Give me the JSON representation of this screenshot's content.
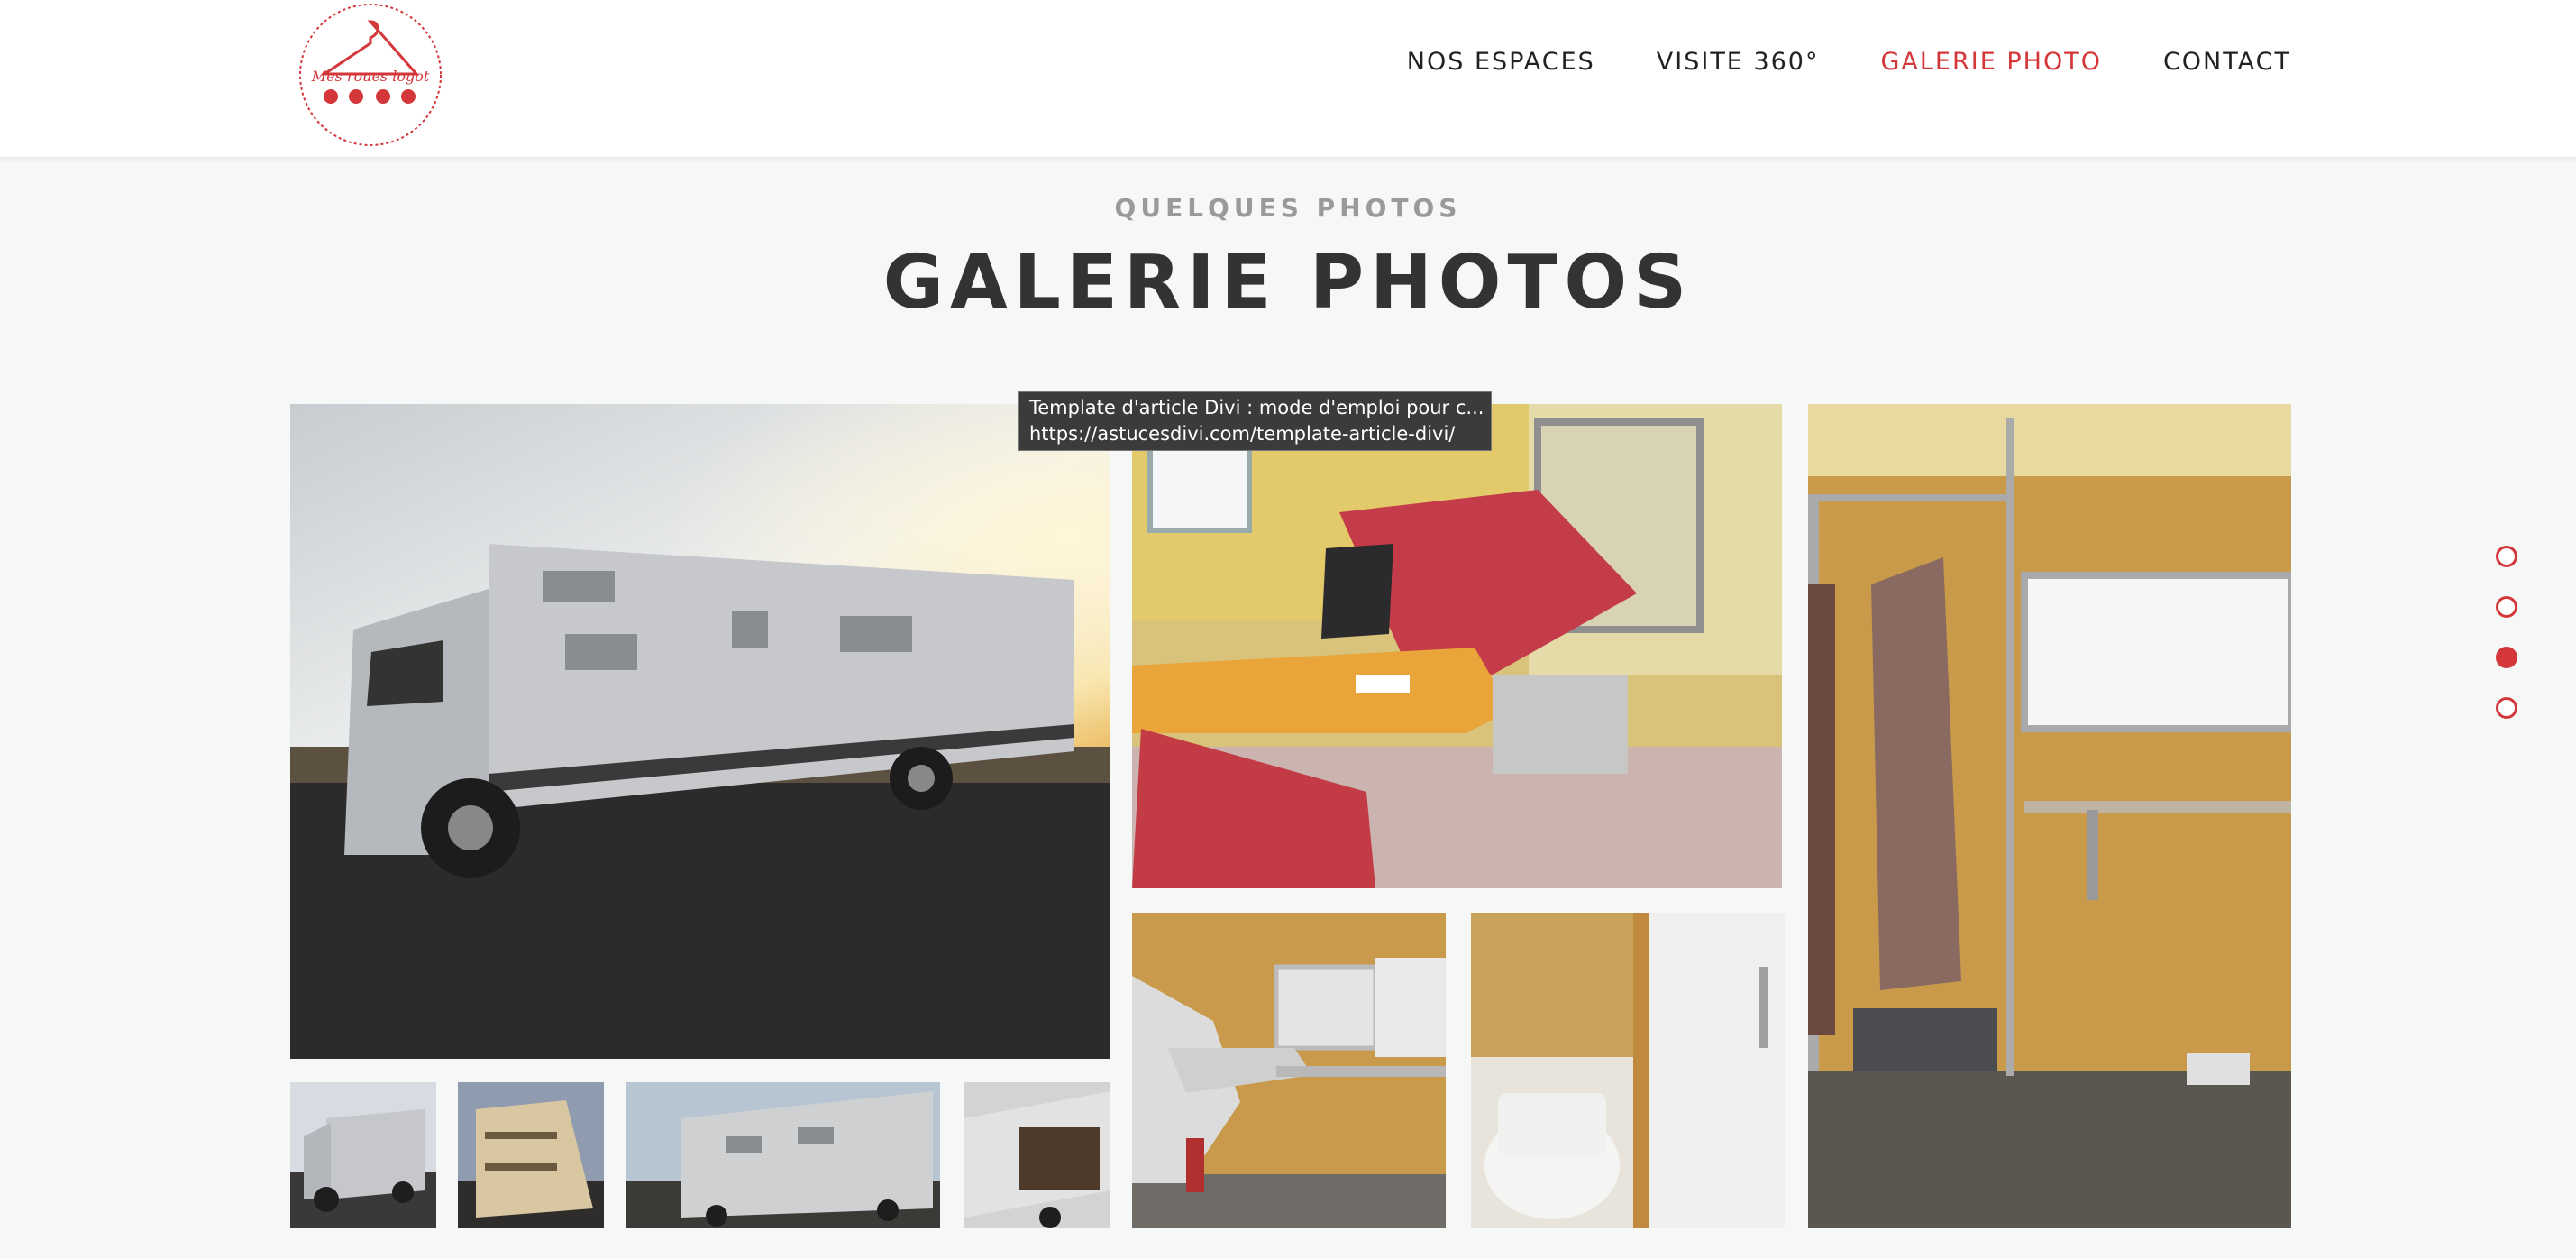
{
  "header": {
    "logo": {
      "text": "Mes roues logot",
      "color": "#d3373a"
    },
    "nav": [
      {
        "label": "NOS ESPACES",
        "active": false
      },
      {
        "label": "VISITE 360°",
        "active": false
      },
      {
        "label": "GALERIE PHOTO",
        "active": true
      },
      {
        "label": "CONTACT",
        "active": false
      }
    ]
  },
  "section": {
    "kicker": "QUELQUES PHOTOS",
    "title": "GALERIE PHOTOS"
  },
  "tooltip": {
    "line1": "Template d'article Divi : mode d'emploi pour c...",
    "line2": "https://astucesdivi.com/template-article-divi/"
  },
  "gallery": [
    {
      "name": "truck-sunset-photo"
    },
    {
      "name": "dining-table-photo"
    },
    {
      "name": "wardrobe-room-photo"
    },
    {
      "name": "salon-chair-photo"
    },
    {
      "name": "toilet-room-photo"
    },
    {
      "name": "thumb-truck-front"
    },
    {
      "name": "thumb-truck-rear"
    },
    {
      "name": "thumb-truck-side"
    },
    {
      "name": "thumb-truck-open"
    }
  ],
  "side_dots": {
    "count": 4,
    "active_index": 2
  },
  "colors": {
    "accent": "#d3373a",
    "text": "#222222",
    "background": "#f6f7f7"
  }
}
